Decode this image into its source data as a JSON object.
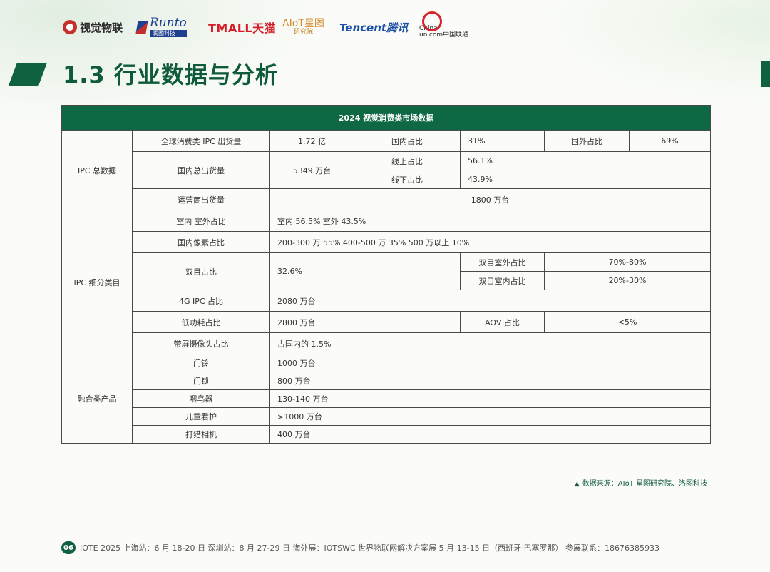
{
  "logos": {
    "shijue": "视觉物联",
    "runto_en": "Runto",
    "runto_cn": "润图科技",
    "tmall": "TMALL天猫",
    "aiot_a": "AIoT星图",
    "aiot_b": "研究院",
    "tencent": "Tencent腾讯",
    "unicom_a": "China",
    "unicom_b": "unicom中国联通"
  },
  "title": "1.3 行业数据与分析",
  "table": {
    "header": "2024 视觉消费类市场数据",
    "groups": {
      "ipc_total": "IPC 总数据",
      "ipc_segment": "IPC 细分类目",
      "fusion": "融合类产品"
    },
    "rows": {
      "global_label": "全球消费类 IPC 出货量",
      "global_value": "1.72 亿",
      "domestic_share_label": "国内占比",
      "domestic_share_value": "31%",
      "overseas_share_label": "国外占比",
      "overseas_share_value": "69%",
      "domestic_total_label": "国内总出货量",
      "domestic_total_value": "5349 万台",
      "online_label": "线上占比",
      "online_value": "56.1%",
      "offline_label": "线下占比",
      "offline_value": "43.9%",
      "operator_label": "运营商出货量",
      "operator_value": "1800 万台",
      "indoor_label": "室内 室外占比",
      "indoor_value": "室内 56.5%   室外 43.5%",
      "pixel_label": "国内像素占比",
      "pixel_value": "200-300 万 55%    400-500 万 35%   500 万以上 10%",
      "dual_label": "双目占比",
      "dual_value": "32.6%",
      "dual_outdoor_label": "双目室外占比",
      "dual_outdoor_value": "70%-80%",
      "dual_indoor_label": "双目室内占比",
      "dual_indoor_value": "20%-30%",
      "g4_label": "4G IPC 占比",
      "g4_value": "2080 万台",
      "lowpower_label": "低功耗占比",
      "lowpower_value": "2800 万台",
      "aov_label": "AOV 占比",
      "aov_value": "<5%",
      "screen_label": "带屏摄像头占比",
      "screen_value": "占国内的 1.5%",
      "doorbell_label": "门铃",
      "doorbell_value": "1000 万台",
      "lock_label": "门锁",
      "lock_value": "800 万台",
      "feeder_label": "喂鸟器",
      "feeder_value": "130-140 万台",
      "child_label": "儿童看护",
      "child_value": ">1000 万台",
      "hunting_label": "打猎相机",
      "hunting_value": "400 万台"
    }
  },
  "source": "数据来源：AIoT 星图研究院、洛图科技",
  "footer": {
    "page_number": "06",
    "text": "IOTE 2025 上海站：6 月 18-20 日    深圳站：8 月 27-29 日    海外展：IOTSWC 世界物联网解决方案展 5 月 13-15 日（西班牙·巴塞罗那）  参展联系：18676385933"
  }
}
